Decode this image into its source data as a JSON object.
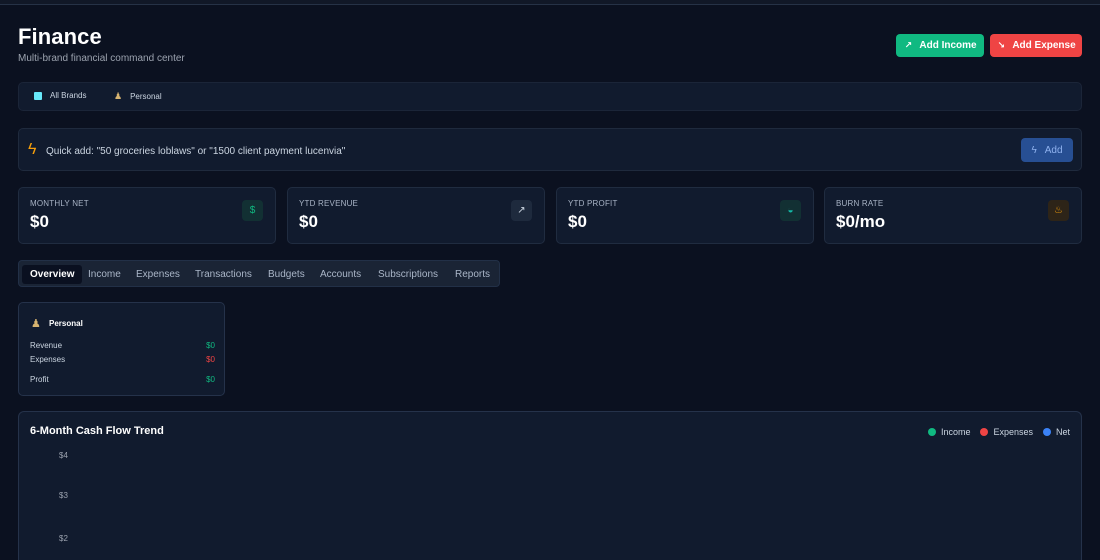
{
  "header": {
    "title": "Finance",
    "subtitle": "Multi-brand financial command center",
    "add_income": {
      "label": "Add Income",
      "icon": "arrow-up-right-icon"
    },
    "add_expense": {
      "label": "Add Expense",
      "icon": "arrow-down-right-icon"
    }
  },
  "brand_filters": [
    {
      "label": "All Brands",
      "icon": "building-icon"
    },
    {
      "label": "Personal",
      "icon": "person-icon"
    }
  ],
  "quick_add": {
    "icon": "lightning-icon",
    "placeholder": "Quick add: \"50 groceries loblaws\" or \"1500 client payment lucenvia\"",
    "button_label": "Add",
    "button_icon": "lightning-icon"
  },
  "stats": [
    {
      "label": "MONTHLY NET",
      "value": "$0",
      "icon": "dollar-icon",
      "accent": "#10b981",
      "icon_bg": "#123033"
    },
    {
      "label": "YTD REVENUE",
      "value": "$0",
      "icon": "trend-up-icon",
      "accent": "#cbd5e1",
      "icon_bg": "#1e2a3d"
    },
    {
      "label": "YTD PROFIT",
      "value": "$0",
      "icon": "piggy-bank-icon",
      "accent": "#14b8a6",
      "icon_bg": "#123033"
    },
    {
      "label": "BURN RATE",
      "value": "$0/mo",
      "icon": "flame-icon",
      "accent": "#f59e0b",
      "icon_bg": "#2d2418"
    }
  ],
  "tabs": [
    "Overview",
    "Income",
    "Expenses",
    "Transactions",
    "Budgets",
    "Accounts",
    "Subscriptions",
    "Reports"
  ],
  "active_tab": "Overview",
  "brand_card": {
    "icon": "person-icon",
    "title": "Personal",
    "rows": [
      {
        "label": "Revenue",
        "value": "$0",
        "color": "#10b981"
      },
      {
        "label": "Expenses",
        "value": "$0",
        "color": "#ef4444"
      },
      {
        "label": "Profit",
        "value": "$0",
        "color": "#10b981"
      }
    ]
  },
  "chart_data": {
    "type": "line",
    "title": "6-Month Cash Flow Trend",
    "series": [
      {
        "name": "Income",
        "color": "#10b981",
        "values": []
      },
      {
        "name": "Expenses",
        "color": "#ef4444",
        "values": []
      },
      {
        "name": "Net",
        "color": "#3b82f6",
        "values": []
      }
    ],
    "ytick_labels": [
      "$4",
      "$3",
      "$2"
    ],
    "legend": "top-right",
    "grid": false
  }
}
